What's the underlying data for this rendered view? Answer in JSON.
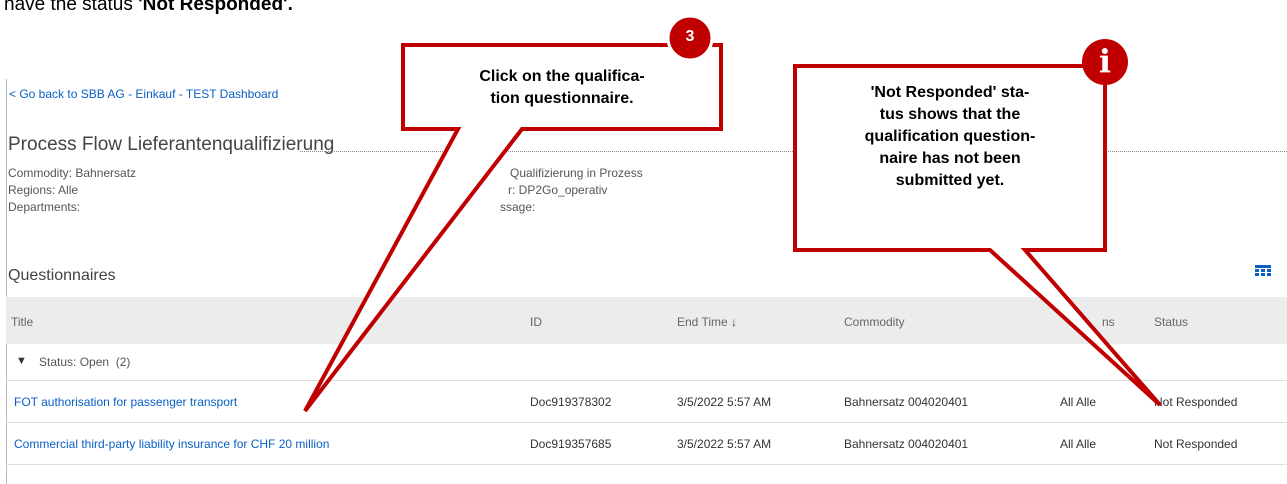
{
  "intro": {
    "prefix": "have the status ",
    "bold": "'Not Responded'."
  },
  "nav": {
    "back_link": "< Go back to SBB AG - Einkauf - TEST Dashboard"
  },
  "page": {
    "title": "Process Flow Lieferantenqualifizierung"
  },
  "meta": {
    "commodity": "Commodity: Bahnersatz",
    "regions": "Regions: Alle",
    "departments": "Departments:",
    "status_value": "Qualifizierung in Prozess",
    "owner_value": "r: DP2Go_operativ",
    "message_label": "ssage:"
  },
  "questionnaires": {
    "title": "Questionnaires",
    "columns": {
      "title": "Title",
      "id": "ID",
      "end_time": "End Time",
      "end_time_sort": "↓",
      "commodity": "Commodity",
      "regions": "ns",
      "status": "Status"
    },
    "group": {
      "label": "Status: Open  (2)"
    },
    "rows": [
      {
        "title": "FOT authorisation for passenger transport",
        "id": "Doc919378302",
        "end_time": "3/5/2022 5:57 AM",
        "commodity": "Bahnersatz 004020401",
        "regions": "All Alle",
        "status": "Not Responded"
      },
      {
        "title": "Commercial third-party liability insurance for CHF 20 million",
        "id": "Doc919357685",
        "end_time": "3/5/2022 5:57 AM",
        "commodity": "Bahnersatz 004020401",
        "regions": "All Alle",
        "status": "Not Responded"
      }
    ]
  },
  "callouts": {
    "step": {
      "badge": "3",
      "text_line1": "Click on the qualifica-",
      "text_line2": "tion questionnaire."
    },
    "info": {
      "badge": "i",
      "line1": "'Not Responded' sta-",
      "line2": "tus shows that the",
      "line3": "qualification question-",
      "line4": "naire has not been",
      "line5": "submitted yet."
    }
  },
  "colors": {
    "accent_red": "#c00000",
    "link_blue": "#0a5fc5",
    "header_bg": "#ececec"
  }
}
